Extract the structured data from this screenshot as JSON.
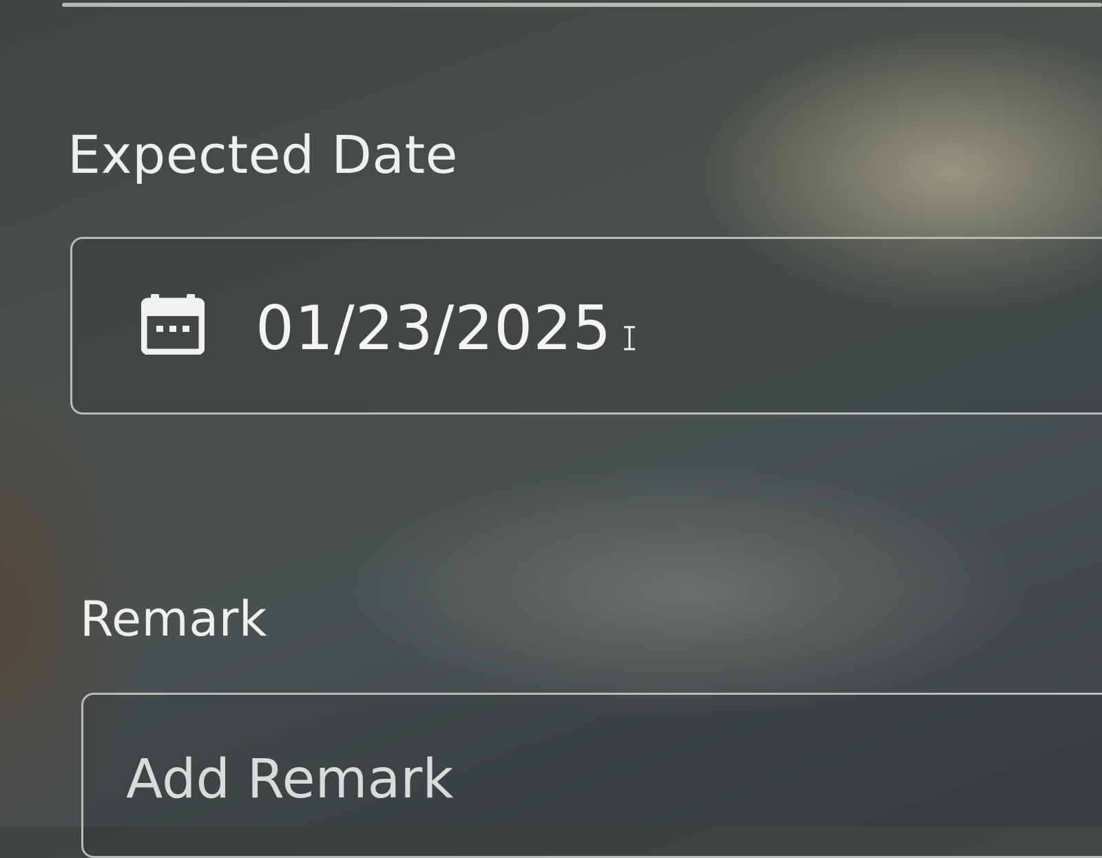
{
  "form": {
    "expected_date": {
      "label": "Expected Date",
      "value": "01/23/2025",
      "icon": "calendar-icon"
    },
    "remark": {
      "label": "Remark",
      "placeholder": "Add Remark"
    }
  },
  "colors": {
    "background": "#474c4a",
    "text": "#eef0ee",
    "border": "#b9bdb9"
  }
}
